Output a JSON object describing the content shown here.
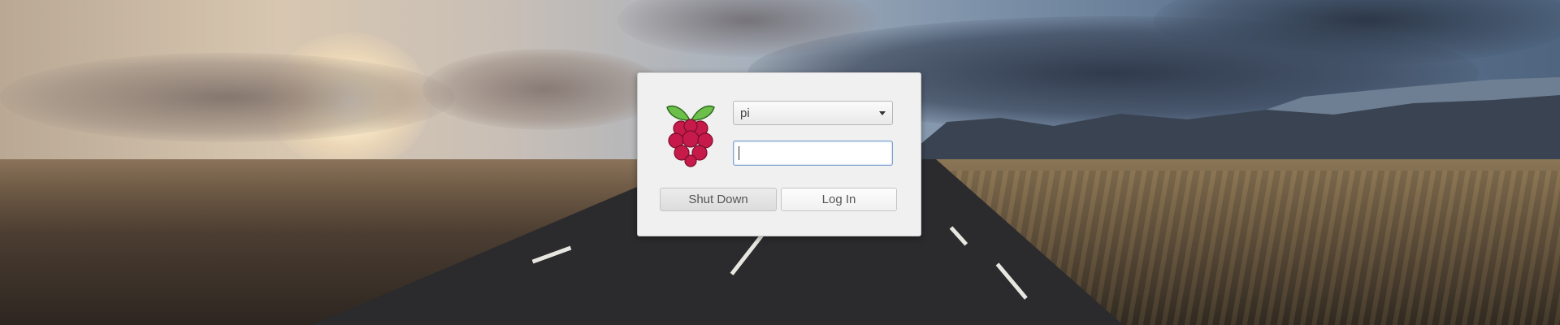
{
  "login_dialog": {
    "user_select": {
      "selected": "pi",
      "icon": "chevron-down-icon"
    },
    "password": {
      "value": "",
      "placeholder": ""
    },
    "logo": {
      "icon": "raspberry-pi-logo"
    },
    "buttons": {
      "shutdown_label": "Shut Down",
      "login_label": "Log In"
    }
  },
  "colors": {
    "dialog_bg": "#f0f0f0",
    "focus_border": "#7ba0cf",
    "berry": "#c51a4a",
    "leaf": "#6cc04a"
  }
}
